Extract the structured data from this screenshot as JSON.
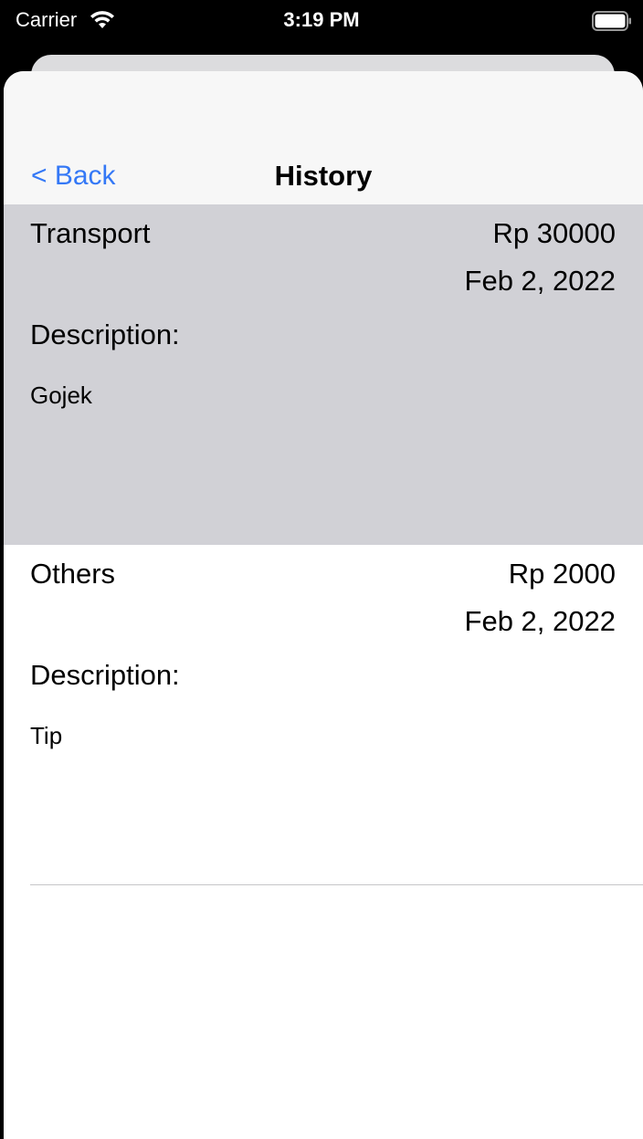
{
  "status_bar": {
    "carrier": "Carrier",
    "time": "3:19 PM",
    "wifi_icon": "wifi-icon",
    "battery_icon": "battery-icon"
  },
  "nav": {
    "back_label": "< Back",
    "title": "History"
  },
  "colors": {
    "accent": "#3478f6",
    "selected_row": "#d1d1d6",
    "nav_background": "#f7f7f7"
  },
  "transactions": [
    {
      "category": "Transport",
      "amount": "Rp 30000",
      "date": "Feb 2, 2022",
      "description_label": "Description:",
      "description": "Gojek",
      "selected": true
    },
    {
      "category": "Others",
      "amount": "Rp 2000",
      "date": "Feb 2, 2022",
      "description_label": "Description:",
      "description": "Tip",
      "selected": false
    }
  ]
}
